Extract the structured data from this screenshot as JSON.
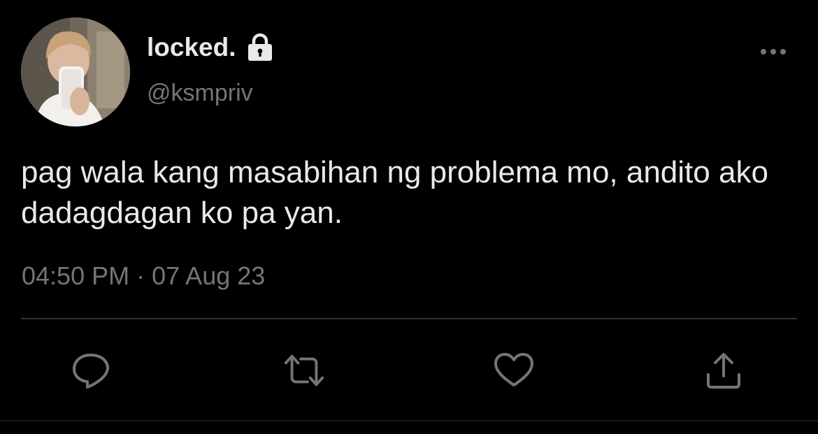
{
  "tweet": {
    "display_name": "locked.",
    "handle": "@ksmpriv",
    "text": "pag wala kang masabihan ng problema mo, andito ako dadagdagan ko pa yan.",
    "time": "04:50 PM",
    "separator": "·",
    "date": "07 Aug 23"
  },
  "icons": {
    "lock": "lock-icon",
    "more": "more-horizontal-icon",
    "reply": "reply-icon",
    "retweet": "retweet-icon",
    "like": "heart-icon",
    "share": "share-icon"
  },
  "colors": {
    "background": "#000000",
    "primary_text": "#e7e9ea",
    "secondary_text": "#71767b",
    "divider": "#2f3336"
  }
}
